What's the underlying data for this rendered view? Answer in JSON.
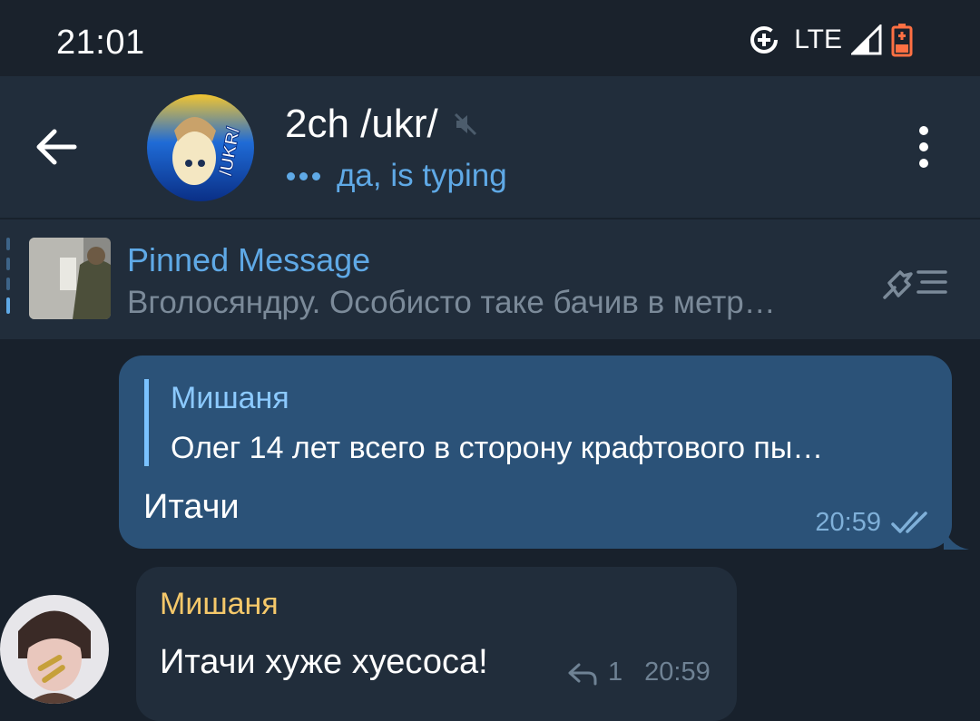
{
  "status_bar": {
    "time": "21:01",
    "network": "LTE",
    "icons": [
      "data-saver-icon",
      "signal-icon",
      "battery-low-icon"
    ]
  },
  "header": {
    "title": "2ch /ukr/",
    "status": "да, is typing",
    "avatar_label": "/UKR/"
  },
  "pinned": {
    "title": "Pinned Message",
    "text": "Вголосяндру. Особисто таке бачив в метр…"
  },
  "messages": [
    {
      "direction": "out",
      "reply_to_name": "Мишаня",
      "reply_to_text": "Олег 14 лет всего в сторону крафтового пы…",
      "text": "Итачи",
      "time": "20:59",
      "read": true
    },
    {
      "direction": "in",
      "sender": "Мишаня",
      "text": "Итачи хуже хуесоса!",
      "reply_count": "1",
      "time": "20:59"
    }
  ],
  "colors": {
    "background": "#18212c",
    "header": "#212d3b",
    "accent": "#5fa9e6",
    "outgoing_bubble": "#2b5278",
    "incoming_bubble": "#212d3b",
    "sender_name": "#f5c86a"
  }
}
